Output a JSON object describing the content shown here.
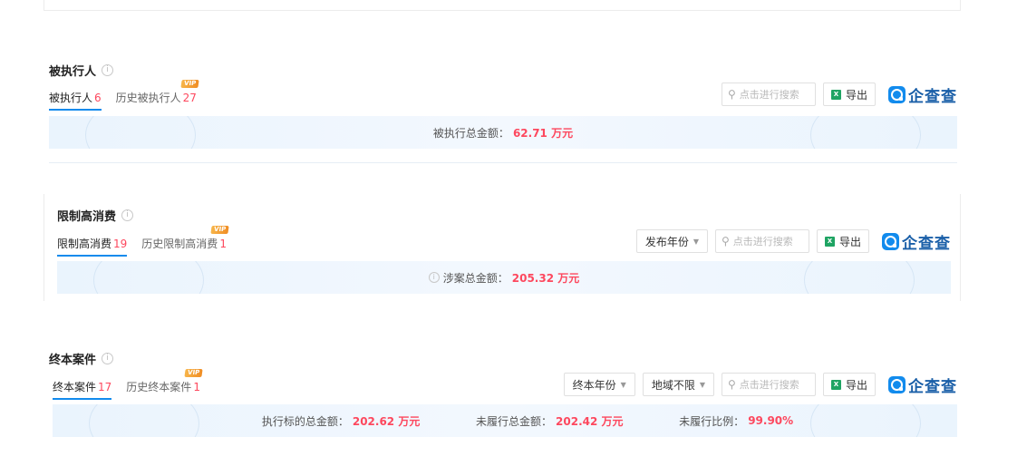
{
  "brand": {
    "name": "企查查"
  },
  "icons": {
    "search": "search-icon",
    "info": "info-icon",
    "excel": "excel-icon",
    "caret": "caret-down-icon"
  },
  "colors": {
    "accent": "#128bed",
    "highlight": "#fd485e",
    "vip": "#f08d24"
  },
  "section1": {
    "title": "被执行人",
    "tab_active": {
      "label": "被执行人",
      "count": "6"
    },
    "tab_history": {
      "label": "历史被执行人",
      "count": "27",
      "badge": "VIP"
    },
    "search_placeholder": "点击进行搜索",
    "export_label": "导出",
    "summary": {
      "label": "被执行总金额：",
      "value": "62.71 万元"
    }
  },
  "section2": {
    "title": "限制高消费",
    "tab_active": {
      "label": "限制高消费",
      "count": "19"
    },
    "tab_history": {
      "label": "历史限制高消费",
      "count": "1",
      "badge": "VIP"
    },
    "filter_year": "发布年份",
    "search_placeholder": "点击进行搜索",
    "export_label": "导出",
    "summary": {
      "label": "涉案总金额：",
      "value": "205.32 万元"
    }
  },
  "section3": {
    "title": "终本案件",
    "tab_active": {
      "label": "终本案件",
      "count": "17"
    },
    "tab_history": {
      "label": "历史终本案件",
      "count": "1",
      "badge": "VIP"
    },
    "filter_year": "终本年份",
    "filter_region": "地域不限",
    "search_placeholder": "点击进行搜索",
    "export_label": "导出",
    "summary": [
      {
        "label": "执行标的总金额：",
        "value": "202.62 万元"
      },
      {
        "label": "未履行总金额：",
        "value": "202.42 万元"
      },
      {
        "label": "未履行比例：",
        "value": "99.90%"
      }
    ]
  }
}
